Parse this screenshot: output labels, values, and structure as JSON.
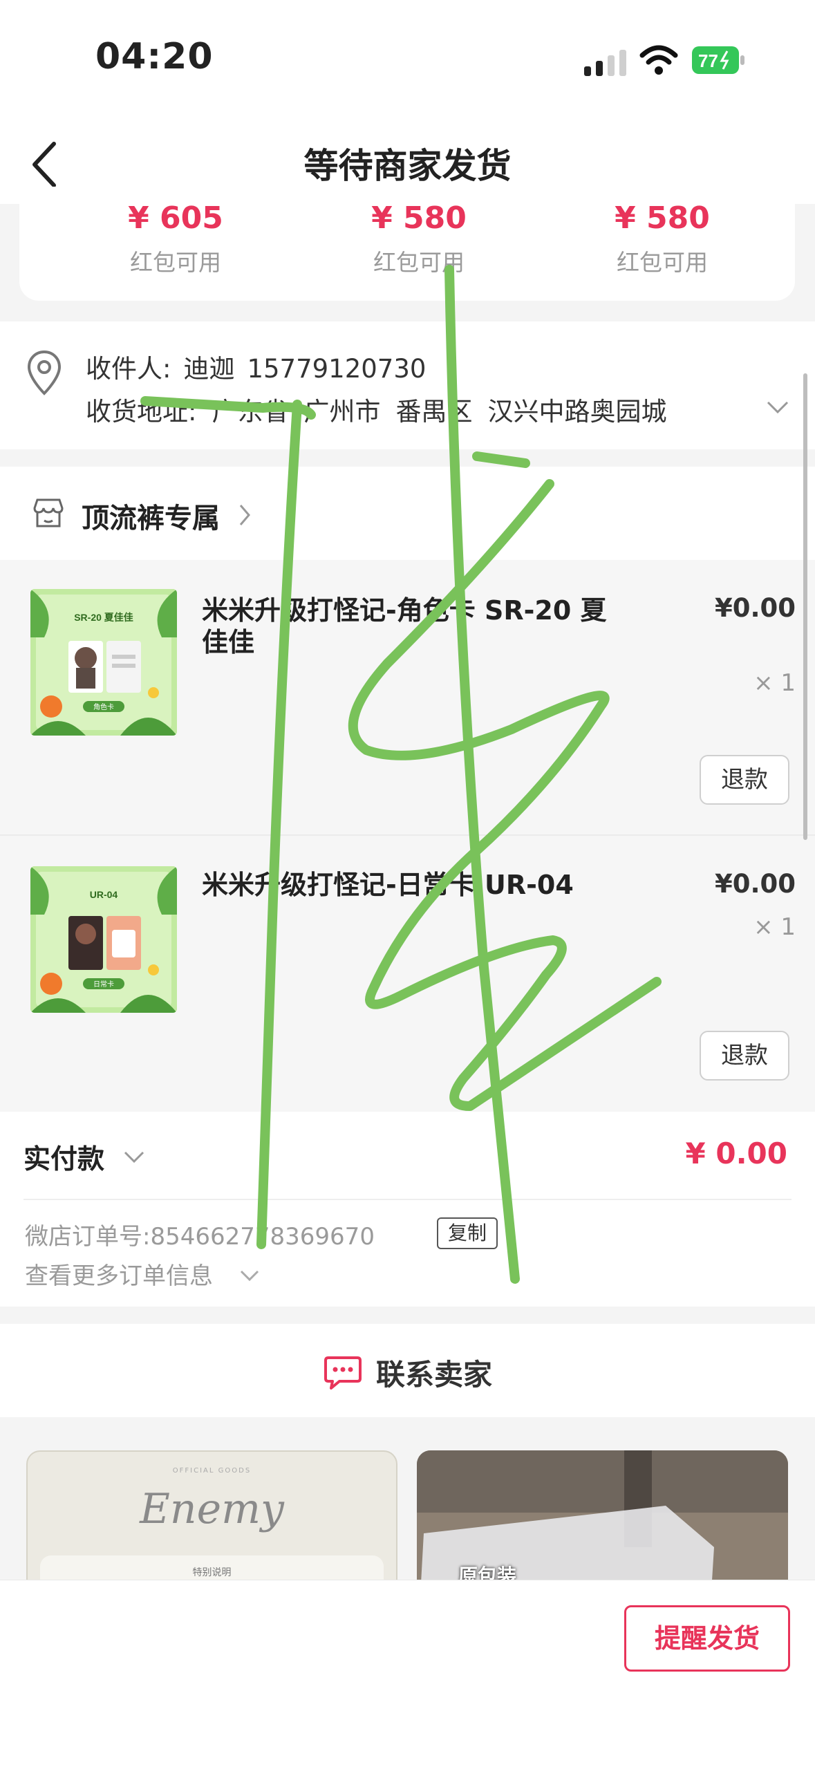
{
  "status_bar": {
    "time": "04:20",
    "battery": "77"
  },
  "header": {
    "title": "等待商家发货"
  },
  "red_packets": [
    {
      "amount": "¥ 605",
      "label": "红包可用"
    },
    {
      "amount": "¥ 580",
      "label": "红包可用"
    },
    {
      "amount": "¥ 580",
      "label": "红包可用"
    }
  ],
  "address": {
    "recipient_label": "收件人:",
    "recipient_name": "迪迦",
    "phone": "15779120730",
    "address_label": "收货地址:",
    "province": "广东省",
    "city": "广州市",
    "district": "番禺区",
    "street": "汉兴中路奥园城"
  },
  "shop": {
    "name": "顶流裤专属"
  },
  "products": [
    {
      "title": "米米升级打怪记-角色卡 SR-20 夏佳佳",
      "price": "¥0.00",
      "qty": "× 1",
      "refund": "退款",
      "thumb_tag": "SR-20 夏佳佳",
      "thumb_btn": "角色卡"
    },
    {
      "title": "米米升级打怪记-日常卡 UR-04",
      "price": "¥0.00",
      "qty": "× 1",
      "refund": "退款",
      "thumb_tag": "UR-04",
      "thumb_btn": "日常卡"
    }
  ],
  "payment": {
    "label": "实付款",
    "amount": "¥ 0.00",
    "order_no_label": "微店订单号:",
    "order_no": "854662778369670",
    "copy": "复制",
    "more_info": "查看更多订单信息"
  },
  "contact": {
    "label": "联系卖家"
  },
  "gallery": {
    "card1_header": "OFFICIAL GOODS",
    "card1_script": "Enemy",
    "card1_note": "特别说明",
    "card2_overlay": "原包装"
  },
  "bottom": {
    "remind": "提醒发货"
  },
  "colors": {
    "accent": "#e8345a",
    "handwriting": "#79c25a"
  }
}
